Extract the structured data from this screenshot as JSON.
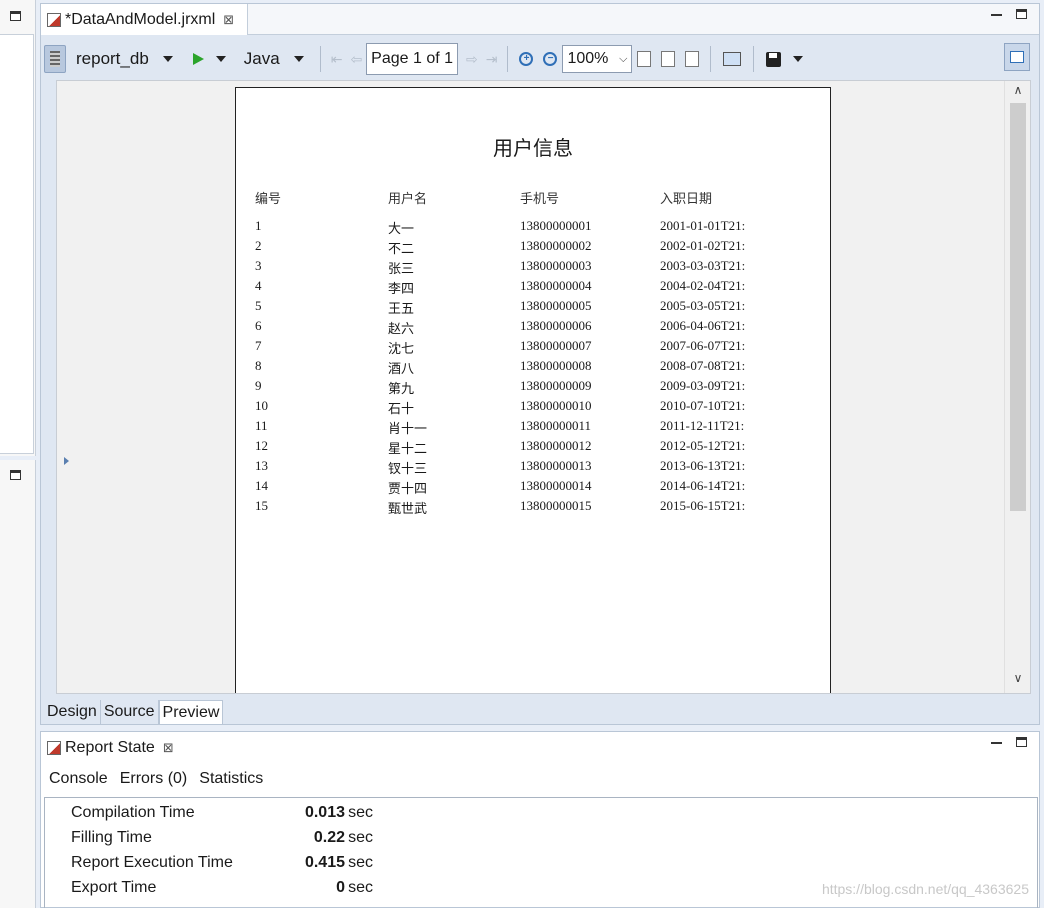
{
  "editor": {
    "tab_title": "*DataAndModel.jrxml",
    "close_glyph": "⊠"
  },
  "toolbar": {
    "datasource": "report_db",
    "language": "Java",
    "page_indicator": "Page 1 of 1",
    "zoom": "100%"
  },
  "report": {
    "title": "用户信息",
    "columns": [
      "编号",
      "用户名",
      "手机号",
      "入职日期"
    ],
    "rows": [
      [
        "1",
        "大一",
        "13800000001",
        "2001-01-01T21:"
      ],
      [
        "2",
        "不二",
        "13800000002",
        "2002-01-02T21:"
      ],
      [
        "3",
        "张三",
        "13800000003",
        "2003-03-03T21:"
      ],
      [
        "4",
        "李四",
        "13800000004",
        "2004-02-04T21:"
      ],
      [
        "5",
        "王五",
        "13800000005",
        "2005-03-05T21:"
      ],
      [
        "6",
        "赵六",
        "13800000006",
        "2006-04-06T21:"
      ],
      [
        "7",
        "沈七",
        "13800000007",
        "2007-06-07T21:"
      ],
      [
        "8",
        "酒八",
        "13800000008",
        "2008-07-08T21:"
      ],
      [
        "9",
        "第九",
        "13800000009",
        "2009-03-09T21:"
      ],
      [
        "10",
        "石十",
        "13800000010",
        "2010-07-10T21:"
      ],
      [
        "11",
        "肖十一",
        "13800000011",
        "2011-12-11T21:"
      ],
      [
        "12",
        "星十二",
        "13800000012",
        "2012-05-12T21:"
      ],
      [
        "13",
        "钗十三",
        "13800000013",
        "2013-06-13T21:"
      ],
      [
        "14",
        "贾十四",
        "13800000014",
        "2014-06-14T21:"
      ],
      [
        "15",
        "甄世武",
        "13800000015",
        "2015-06-15T21:"
      ]
    ]
  },
  "bottom_tabs": [
    "Design",
    "Source",
    "Preview"
  ],
  "state_panel": {
    "title": "Report State",
    "subtabs": [
      "Console",
      "Errors (0)",
      "Statistics"
    ],
    "stats": [
      {
        "label": "Compilation Time",
        "value": "0.013",
        "unit": "sec"
      },
      {
        "label": "Filling Time",
        "value": "0.22",
        "unit": "sec"
      },
      {
        "label": "Report Execution Time",
        "value": "0.415",
        "unit": "sec"
      },
      {
        "label": "Export Time",
        "value": "0",
        "unit": "sec"
      }
    ],
    "watermark": "https://blog.csdn.net/qq_4363625"
  }
}
